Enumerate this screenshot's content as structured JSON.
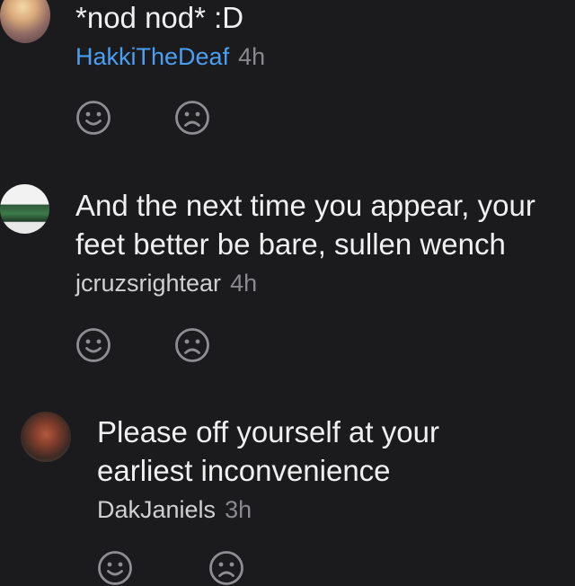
{
  "comments": [
    {
      "text_lines": [
        "*nod nod* :D"
      ],
      "username": "HakkiTheDeaf",
      "time": "4h",
      "reactions": [
        "smile-icon",
        "frown-icon"
      ]
    },
    {
      "text_lines": [
        "And the next time you appear, your",
        "feet better be bare, sullen wench"
      ],
      "username": "jcruzsrightear",
      "time": "4h",
      "reactions": [
        "smile-icon",
        "frown-icon"
      ]
    },
    {
      "text_lines": [
        "Please off yourself at your",
        "earliest inconvenience"
      ],
      "username": "DakJaniels",
      "time": "3h",
      "reactions": [
        "smile-icon",
        "frown-icon"
      ]
    }
  ],
  "colors": {
    "background": "#1b1b1d",
    "username_highlight": "#4a9ff5",
    "muted": "#8a8a8e",
    "icon": "#8e8e92"
  }
}
